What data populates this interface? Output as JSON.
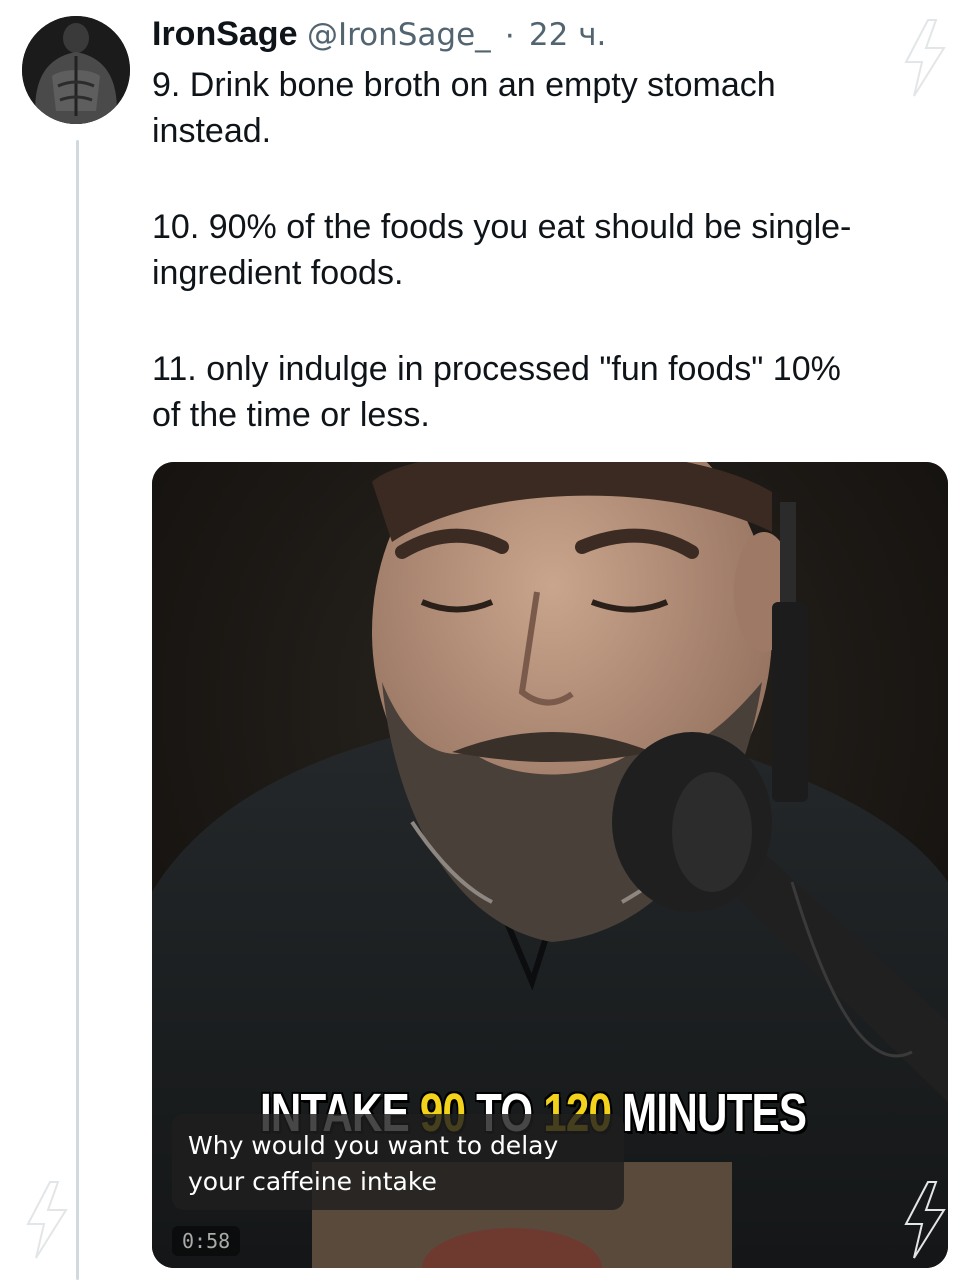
{
  "tweet": {
    "author_name": "IronSage",
    "author_handle": "@IronSage_",
    "separator": "·",
    "timestamp": "22 ч.",
    "paragraphs": [
      "9.  Drink bone broth on an empty stomach\ninstead.",
      "10.  90% of the foods you eat should be single-\ningredient foods.",
      "11.  only indulge in processed \"fun foods\" 10%\nof the time or less."
    ]
  },
  "video": {
    "caption_parts": [
      "INTAKE ",
      "90",
      " TO ",
      "120",
      " MINUTES"
    ],
    "subtitle": "Why would you want to delay your caffeine intake",
    "duration": "0:58"
  },
  "colors": {
    "text": "#0f1419",
    "secondary": "#536471",
    "thread_line": "#cfd9de",
    "caption_highlight": "#f2d21b"
  },
  "icons": {
    "watermark": "lightning-bolt-icon"
  }
}
